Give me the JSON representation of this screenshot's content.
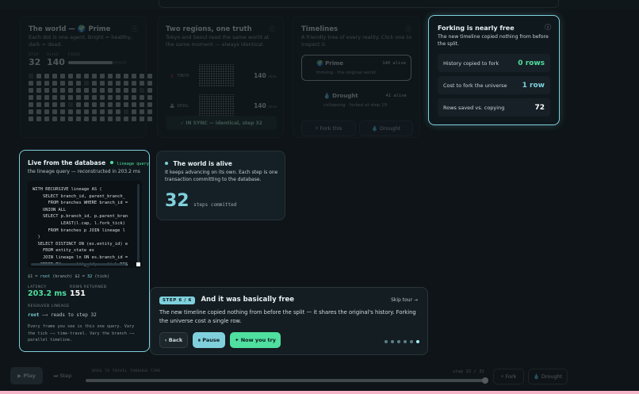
{
  "world": {
    "title": "The world —",
    "title_emoji": "🌍",
    "title_name": "Prime",
    "desc": "Each dot is one agent. Bright = healthy, dark = dead.",
    "stat1_label": "STEP",
    "stat1_value": "32",
    "stat2_label": "ALIVE",
    "stat2_value": "140",
    "stat3_label": "FOOD",
    "food_fraction": 0.75
  },
  "regions": {
    "title": "Two regions, one truth",
    "desc": "Tokyo and Seoul read the same world at the same moment — always identical.",
    "tokyo_label": "🗼 TOKYO",
    "tokyo_value": "140",
    "tokyo_unit": "alive",
    "seoul_label": "🏯 SEOUL",
    "seoul_value": "140",
    "seoul_unit": "alive",
    "sync_label": "✓ IN SYNC — identical, step 32"
  },
  "timelines": {
    "title": "Timelines",
    "desc": "A friendly tree of every reality. Click one to inspect it.",
    "prime_name": "🌍 Prime",
    "prime_count": "140 alive",
    "prime_status": "thriving · the original world",
    "drought_name": "💧 Drought",
    "drought_count": "41 alive",
    "drought_status": "collapsing · forked at step 19",
    "fork_button": "⑂ Fork this",
    "drought_button": "💧 Drought"
  },
  "forking": {
    "title": "Forking is nearly free",
    "desc": "The new timeline copied nothing from before the split.",
    "row1_label": "History copied to fork",
    "row1_value": "0 rows",
    "row2_label": "Cost to fork the universe",
    "row2_value": "1 row",
    "row3_label": "Rows saved vs. copying",
    "row3_value": "72",
    "colors": {
      "green": "#4fe0a0",
      "cyan": "#7fd0dc"
    }
  },
  "live": {
    "title": "Live from the database",
    "badge": "lineage query",
    "subtitle": "the lineage query — reconstructed in 203.2 ms",
    "code": [
      "WITH RECURSIVE lineage AS (",
      "    SELECT branch_id, parent_branch_",
      "      FROM branches WHERE branch_id =",
      "    UNION ALL",
      "    SELECT p.branch_id, p.parent_bran",
      "           LEAST(l.cap, l.fork_tick)",
      "      FROM branches p JOIN lineage l",
      "  )",
      "  SELECT DISTINCT ON (es.entity_id) e",
      "    FROM entity_state es",
      "    JOIN lineage ln ON es.branch_id =",
      "   ORDER BY es.entity_id, es.tick DES"
    ],
    "params_prefix1": "$1 = ",
    "params_val1": "root",
    "params_mid": " (branch)  $2 = ",
    "params_val2": "32",
    "params_suffix": " (tick)",
    "latency_label": "LATENCY",
    "latency_value": "203.2 ms",
    "rows_label": "ROWS RETURNED",
    "rows_value": "151",
    "resolved_label": "RESOLVED LINEAGE",
    "resolved_root": "root",
    "resolved_rest": " —→ reads to step 32",
    "footer": "Every frame you see is this one query. Vary the tick —→ time-travel. Vary the branch —→ parallel timeline."
  },
  "alive": {
    "title": "The world is alive",
    "desc": "It keeps advancing on its own. Each step is one transaction committing to the database.",
    "steps_value": "32",
    "steps_label": "steps committed"
  },
  "tour": {
    "step_pill": "STEP 6 / 6",
    "title": "And it was basically free",
    "skip": "Skip tour →",
    "body": "The new timeline copied nothing from before the split — it shares the original's history. Forking the universe cost a single row.",
    "back": "‹ Back",
    "pause": "⏸ Pause",
    "try": "✦ Now you try",
    "dots_total": 6,
    "dots_active": 6
  },
  "bottom": {
    "play": "▶ Play",
    "step": "⏭ Step",
    "drag_label": "DRAG TO TRAVEL THROUGH TIME",
    "step_readout": "step 32 / 32",
    "fork": "⑂ Fork",
    "drought": "💧 Drought",
    "progress": 1.0
  }
}
